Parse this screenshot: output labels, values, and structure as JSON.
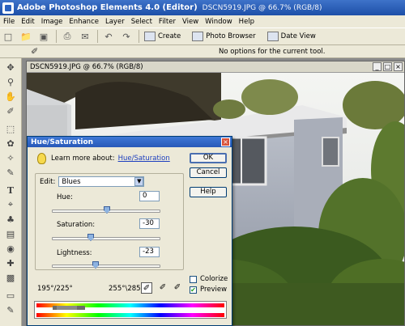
{
  "window": {
    "app_title": "Adobe Photoshop Elements 4.0 (Editor)",
    "doc_info": "DSCN5919.JPG @ 66.7% (RGB/8)"
  },
  "menu": [
    "File",
    "Edit",
    "Image",
    "Enhance",
    "Layer",
    "Select",
    "Filter",
    "View",
    "Window",
    "Help"
  ],
  "toolbar": {
    "create": "Create",
    "photo_browser": "Photo Browser",
    "date_view": "Date View"
  },
  "options_bar": {
    "text": "No options for the current tool."
  },
  "document": {
    "title": "DSCN5919.JPG @ 66.7% (RGB/8)"
  },
  "dialog": {
    "title": "Hue/Saturation",
    "learn_prefix": "Learn more about:",
    "learn_link": "Hue/Saturation",
    "edit_label": "Edit:",
    "edit_value": "Blues",
    "hue_label": "Hue:",
    "hue_value": "0",
    "saturation_label": "Saturation:",
    "saturation_value": "-30",
    "lightness_label": "Lightness:",
    "lightness_value": "-23",
    "ok": "OK",
    "cancel": "Cancel",
    "help": "Help",
    "colorize": "Colorize",
    "preview": "Preview",
    "range_left": "195°/225°",
    "range_right": "255°\\285°"
  },
  "colors": {
    "title_blue": "#1d4fa8",
    "dialog_bg": "#ece9d8",
    "link": "#1d3fbf"
  },
  "icons": [
    "new-icon",
    "open-icon",
    "save-icon",
    "print-icon",
    "email-icon",
    "undo-icon",
    "redo-icon",
    "move-tool-icon",
    "eyedropper-icon"
  ]
}
